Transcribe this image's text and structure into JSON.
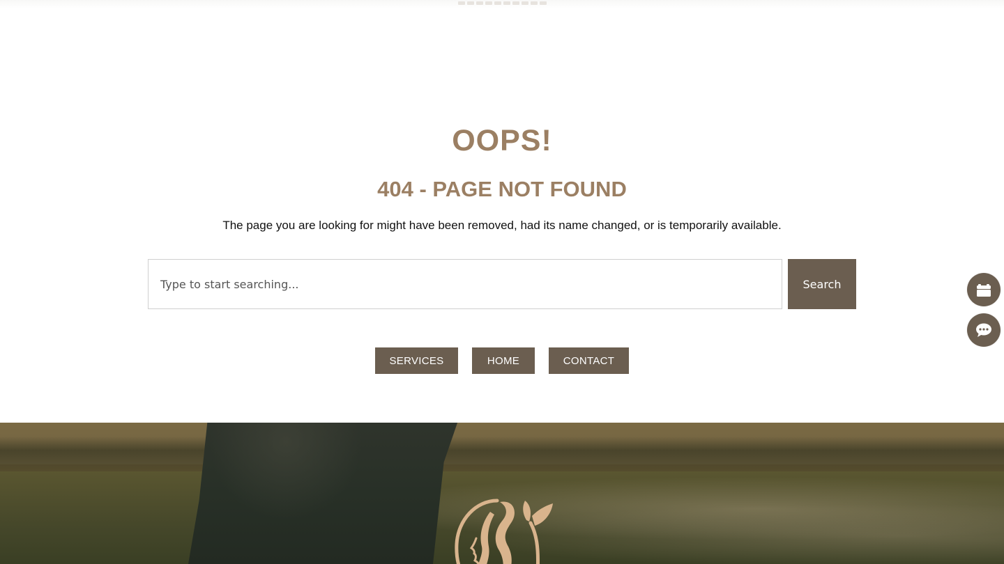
{
  "error": {
    "headline": "OOPS!",
    "title": "404 - PAGE NOT FOUND",
    "message": "The page you are looking for might have been removed, had its name changed, or is temporarily available."
  },
  "search": {
    "placeholder": "Type to start searching...",
    "value": "",
    "button_label": "Search"
  },
  "nav_buttons": [
    {
      "label": "SERVICES"
    },
    {
      "label": "HOME"
    },
    {
      "label": "CONTACT"
    }
  ],
  "floating_actions": [
    {
      "icon": "calendar-icon"
    },
    {
      "icon": "chat-icon"
    }
  ],
  "footer": {
    "logo_icon": "woman-profile-leaf-logo"
  },
  "colors": {
    "heading": "#9b7f63",
    "button_bg": "#6b5e50",
    "button_text": "#ffffff",
    "text": "#111111",
    "logo": "#d9b48d"
  }
}
